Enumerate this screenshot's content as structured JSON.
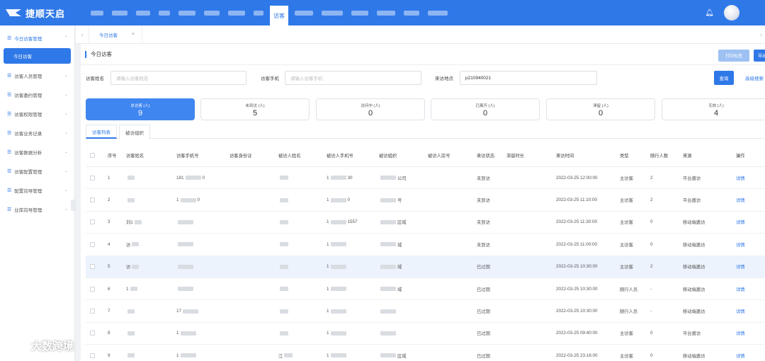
{
  "app": {
    "name": "捷顺天启"
  },
  "topnav": {
    "active_label": "访客"
  },
  "sidebar": {
    "items": [
      {
        "label": "今日访客管理",
        "open": true
      },
      {
        "label": "访客人员管理"
      },
      {
        "label": "访客邀约管理"
      },
      {
        "label": "访客权限管理"
      },
      {
        "label": "访客业务记录"
      },
      {
        "label": "访客数据分析"
      },
      {
        "label": "访客配置管理"
      },
      {
        "label": "配置向导管理"
      },
      {
        "label": "业库向导管理"
      }
    ],
    "sub_active": "今日访客"
  },
  "tabs": {
    "current": "今日访客"
  },
  "page": {
    "title": "今日访客",
    "print_button": "打印标签",
    "export_button": "导出"
  },
  "filters": {
    "name_label": "访客姓名",
    "name_placeholder": "请输入访客姓名",
    "phone_label": "访客手机",
    "phone_placeholder": "请输入访客手机",
    "org_label": "来访地点",
    "org_value": "p210940021",
    "search_button": "查询",
    "advanced_link": "高级搜索"
  },
  "stats": [
    {
      "label": "总访客 (人)",
      "value": "9",
      "active": true
    },
    {
      "label": "未到访 (人)",
      "value": "5"
    },
    {
      "label": "访问中 (人)",
      "value": "0"
    },
    {
      "label": "已离开 (人)",
      "value": "0"
    },
    {
      "label": "滞留 (人)",
      "value": "0"
    },
    {
      "label": "无效 (人)",
      "value": "4"
    }
  ],
  "subtabs": {
    "list": "访客列表",
    "org": "被访组织"
  },
  "table": {
    "headers": {
      "seq": "序号",
      "name": "访客姓名",
      "phone": "访客手机号",
      "id": "访客身份证",
      "host": "被访人姓名",
      "host_phone": "被访人手机号",
      "org": "被访组织",
      "room": "被访人房号",
      "status": "来访状态",
      "stay": "滞留时长",
      "time": "来访时间",
      "type": "类型",
      "companions": "随行人数",
      "source": "来源",
      "action": "操作"
    },
    "rows": [
      {
        "seq": "1",
        "name": "",
        "phone": "181",
        "phone_tail": "0",
        "host": "",
        "host_phone": "1",
        "host_phone_tail": "30",
        "org": "",
        "org_tail": "公司",
        "status": "未到访",
        "time": "2022-03-25 12:00:00",
        "type": "主访客",
        "companions": "2",
        "source": "平台邀访",
        "action": "详情"
      },
      {
        "seq": "2",
        "name": "",
        "phone": "1",
        "phone_tail": "0",
        "host": "",
        "host_phone": "1",
        "host_phone_tail": "0",
        "org": "",
        "org_tail": "号",
        "status": "未到访",
        "time": "2022-03-25 11:10:00",
        "type": "主访客",
        "companions": "2",
        "source": "平台邀访",
        "action": "详情"
      },
      {
        "seq": "3",
        "name": "刘1",
        "phone": "",
        "phone_tail": "",
        "host": "",
        "host_phone": "1",
        "host_phone_tail": "1557",
        "org": "",
        "org_tail": "区域",
        "status": "未到访",
        "time": "2022-03-25 11:30:00",
        "type": "主访客",
        "companions": "0",
        "source": "移动端邀访",
        "action": "详情"
      },
      {
        "seq": "4",
        "name": "访",
        "phone": "",
        "phone_tail": "",
        "host": "",
        "host_phone": "1",
        "host_phone_tail": "",
        "org": "",
        "org_tail": "域",
        "status": "未到访",
        "time": "2022-03-25 11:00:00",
        "type": "主访客",
        "companions": "0",
        "source": "移动端邀访",
        "action": "详情"
      },
      {
        "seq": "5",
        "name": "访",
        "phone": "",
        "phone_tail": "",
        "host": "",
        "host_phone": "1",
        "host_phone_tail": "",
        "org": "",
        "org_tail": "域",
        "status": "已过期",
        "time": "2022-03-25 10:30:00",
        "type": "主访客",
        "companions": "2",
        "source": "移动端邀访",
        "action": "详情"
      },
      {
        "seq": "6",
        "name": "1",
        "phone": "",
        "phone_tail": "",
        "host": "",
        "host_phone": "1",
        "host_phone_tail": "",
        "org": "",
        "org_tail": "域",
        "status": "已过期",
        "time": "2022-03-25 10:30:00",
        "type": "随行人员",
        "companions": "-",
        "source": "移动端邀访",
        "action": "详情"
      },
      {
        "seq": "7",
        "name": "",
        "phone": "17",
        "phone_tail": "",
        "host": "",
        "host_phone": "1",
        "host_phone_tail": "",
        "org": "",
        "org_tail": "",
        "status": "已过期",
        "time": "2022-03-25 10:30:00",
        "type": "随行人员",
        "companions": "-",
        "source": "移动端邀访",
        "action": "详情"
      },
      {
        "seq": "8",
        "name": "",
        "phone": "1",
        "phone_tail": "",
        "host": "",
        "host_phone": "1",
        "host_phone_tail": "",
        "org": "",
        "org_tail": "",
        "status": "已过期",
        "time": "2022-03-25 09:40:00",
        "type": "主访客",
        "companions": "0",
        "source": "平台邀访",
        "action": "详情"
      },
      {
        "seq": "9",
        "name": "",
        "phone": "1",
        "phone_tail": "",
        "host": "江",
        "host_phone": "1",
        "host_phone_tail": "",
        "org": "",
        "org_tail": "区域",
        "status": "已过期",
        "time": "2022-03-25 23:16:00",
        "type": "主访客",
        "companions": "0",
        "source": "移动端邀访",
        "action": "详情"
      }
    ]
  },
  "watermark": {
    "text": "大数跨境"
  },
  "colors": {
    "primary": "#2f78e8",
    "topbar": "#2f78e8",
    "row_highlight": "#ecf3fd"
  }
}
